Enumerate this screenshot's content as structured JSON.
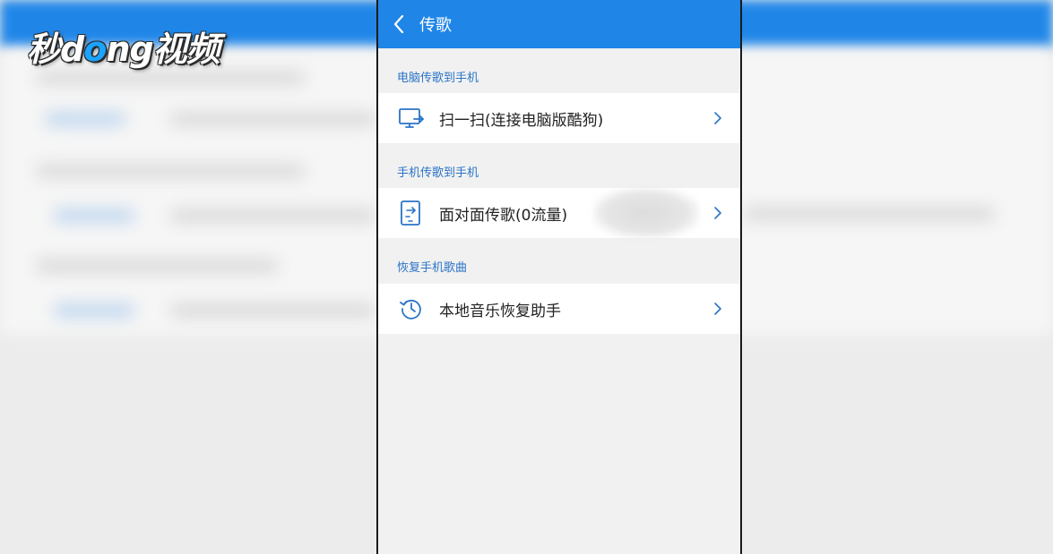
{
  "watermark": {
    "brand_part1": "秒",
    "brand_part2": "d",
    "brand_o": "o",
    "brand_part3": "ng视频"
  },
  "header": {
    "title": "传歌"
  },
  "sections": [
    {
      "title": "电脑传歌到手机",
      "item": {
        "label": "扫一扫(连接电脑版酷狗)",
        "icon": "monitor-icon"
      }
    },
    {
      "title": "手机传歌到手机",
      "item": {
        "label": "面对面传歌(0流量)",
        "icon": "phone-transfer-icon"
      }
    },
    {
      "title": "恢复手机歌曲",
      "item": {
        "label": "本地音乐恢复助手",
        "icon": "history-icon"
      }
    }
  ],
  "colors": {
    "primary": "#1f86e8",
    "section_title": "#2a74c6",
    "icon": "#2a74c6"
  }
}
